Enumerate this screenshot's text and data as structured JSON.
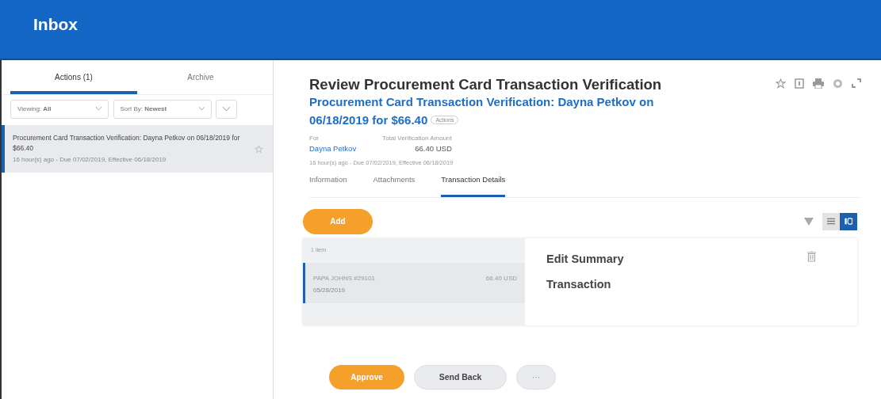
{
  "header": {
    "title": "Inbox"
  },
  "inbox_tabs": [
    {
      "label": "Actions (1)",
      "selected": true
    },
    {
      "label": "Archive",
      "selected": false
    }
  ],
  "filters": [
    {
      "label": "Viewing: **All**"
    },
    {
      "label": "Sort By: **Newest**"
    }
  ],
  "inbox_items": [
    {
      "title": "Procurement Card Transaction Verification: Dayna Petkov on 06/18/2019 for $66.40",
      "meta": "16 hour(s) ago - Due 07/02/2019, Effective 06/18/2019",
      "selected": true,
      "starred": false
    }
  ],
  "task": {
    "title": "Review Procurement Card Transaction Verification",
    "subtitle": "Procurement Card Transaction Verification: Dayna Petkov on 06/18/2019 for $66.40",
    "actions_label": "Actions",
    "fields": [
      {
        "label": "For",
        "value": "Dayna Petkov",
        "kind": "link"
      },
      {
        "label": "Total Verification Amount",
        "value": "66.40 USD",
        "kind": "amount"
      }
    ],
    "meta": "16 hour(s) ago - Due 07/02/2019, Effective 06/18/2019"
  },
  "task_tabs": [
    {
      "label": "Information",
      "selected": false
    },
    {
      "label": "Attachments",
      "selected": false
    },
    {
      "label": "Transaction Details",
      "selected": true
    }
  ],
  "add_button": "Add",
  "view_modes": [
    {
      "kind": "list",
      "selected": false
    },
    {
      "kind": "detail",
      "selected": true
    }
  ],
  "transactions": {
    "count": "1 item",
    "rows": [
      {
        "merchant": "PAPA JOHNS #29101",
        "amount": "66.40 USD",
        "date": "05/28/2019",
        "selected": true
      }
    ]
  },
  "detail": {
    "title": "Edit Summary",
    "subtitle": "Transaction"
  },
  "footer_buttons": [
    {
      "label": "Approve",
      "kind": "primary"
    },
    {
      "label": "Send Back",
      "kind": "secondary"
    },
    {
      "label": "···",
      "kind": "more"
    }
  ]
}
